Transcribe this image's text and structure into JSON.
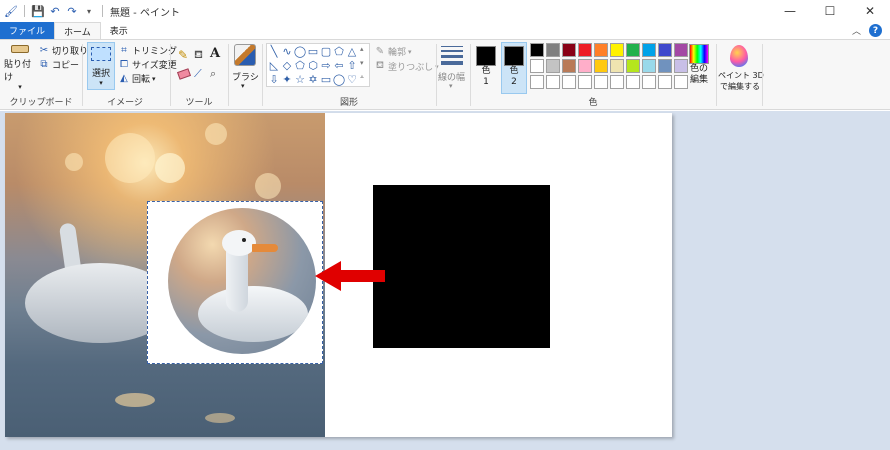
{
  "window": {
    "title": "無題 - ペイント",
    "controls": [
      "—",
      "☐",
      "✕"
    ]
  },
  "tabs": [
    {
      "label": "ファイル"
    },
    {
      "label": "ホーム"
    },
    {
      "label": "表示"
    }
  ],
  "ribbon": {
    "clipboard": {
      "paste": "貼り付け",
      "cut": "切り取り",
      "copy": "コピー",
      "group": "クリップボード"
    },
    "image": {
      "select": "選択",
      "crop": "トリミング",
      "resize": "サイズ変更",
      "rotate": "回転",
      "group": "イメージ"
    },
    "tools": {
      "group": "ツール"
    },
    "brushes": {
      "label": "ブラシ"
    },
    "shapes": {
      "outline": "輪郭",
      "fill": "塗りつぶし",
      "group": "図形"
    },
    "size": {
      "label": "線の幅"
    },
    "colors": {
      "color1_line1": "色",
      "color1_line2": "1",
      "color2_line1": "色",
      "color2_line2": "2",
      "edit_line1": "色の",
      "edit_line2": "編集",
      "group": "色",
      "palette_row1": [
        "#000000",
        "#7f7f7f",
        "#880015",
        "#ed1c24",
        "#ff7f27",
        "#fff200",
        "#22b14c",
        "#00a2e8",
        "#3f48cc",
        "#a349a4"
      ],
      "palette_row2": [
        "#ffffff",
        "#c3c3c3",
        "#b97a57",
        "#ffaec9",
        "#ffc90e",
        "#efe4b0",
        "#b5e61d",
        "#99d9ea",
        "#7092be",
        "#c8bfe7"
      ]
    },
    "paint3d": {
      "line1": "ペイント 3D",
      "line2": "で編集する"
    }
  },
  "colors": {
    "accent": "#1e6fd0",
    "arrow": "#e00000"
  }
}
